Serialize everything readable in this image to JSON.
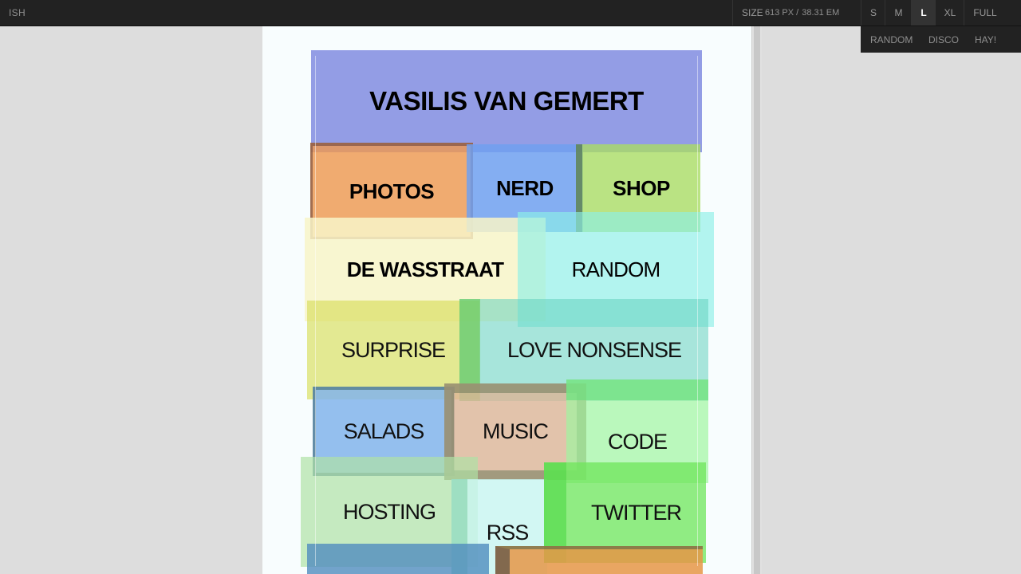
{
  "toolbar": {
    "brand": "ISH",
    "size_label": "SIZE",
    "size_px": "613 PX /",
    "size_em": "38.31 EM",
    "sizes": [
      "S",
      "M",
      "L",
      "XL",
      "FULL"
    ],
    "active_size": "L",
    "extras": [
      "RANDOM",
      "DISCO",
      "HAY!"
    ]
  },
  "site": {
    "title": "VASILIS VAN GEMERT",
    "tiles": [
      "PHOTOS",
      "NERD",
      "SHOP",
      "DE WASSTRAAT",
      "RANDOM",
      "SURPRISE",
      "LOVE NONSENSE",
      "SALADS",
      "MUSIC",
      "CODE",
      "HOSTING",
      "RSS",
      "TWITTER"
    ]
  }
}
